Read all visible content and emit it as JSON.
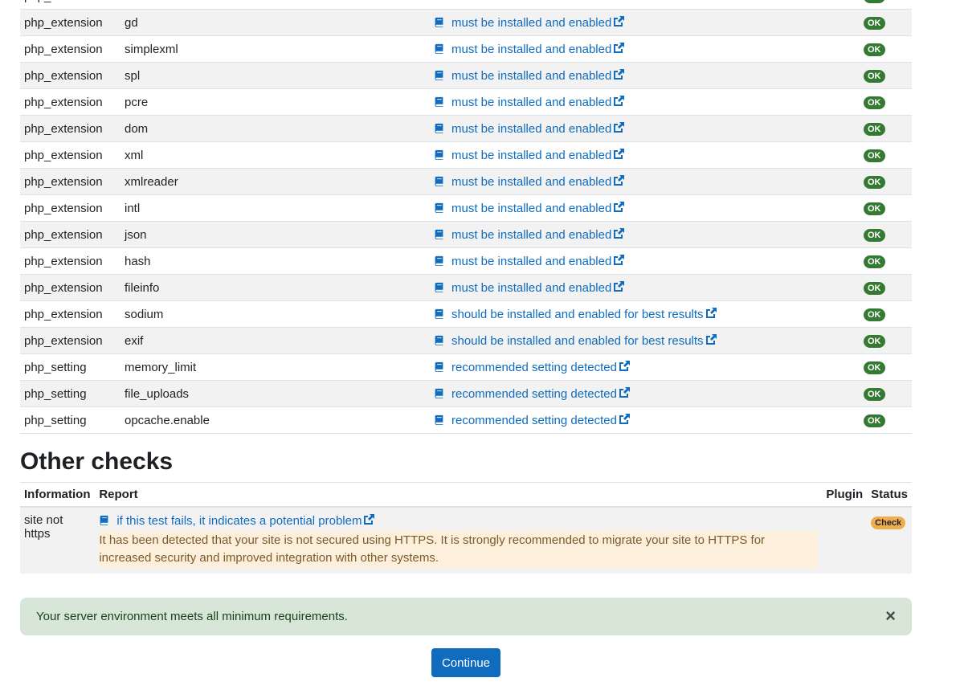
{
  "env_rows": [
    {
      "type": "php_extension",
      "name": "",
      "report": "",
      "status": "OK"
    },
    {
      "type": "php_extension",
      "name": "gd",
      "report": "must be installed and enabled",
      "status": "OK"
    },
    {
      "type": "php_extension",
      "name": "simplexml",
      "report": "must be installed and enabled",
      "status": "OK"
    },
    {
      "type": "php_extension",
      "name": "spl",
      "report": "must be installed and enabled",
      "status": "OK"
    },
    {
      "type": "php_extension",
      "name": "pcre",
      "report": "must be installed and enabled",
      "status": "OK"
    },
    {
      "type": "php_extension",
      "name": "dom",
      "report": "must be installed and enabled",
      "status": "OK"
    },
    {
      "type": "php_extension",
      "name": "xml",
      "report": "must be installed and enabled",
      "status": "OK"
    },
    {
      "type": "php_extension",
      "name": "xmlreader",
      "report": "must be installed and enabled",
      "status": "OK"
    },
    {
      "type": "php_extension",
      "name": "intl",
      "report": "must be installed and enabled",
      "status": "OK"
    },
    {
      "type": "php_extension",
      "name": "json",
      "report": "must be installed and enabled",
      "status": "OK"
    },
    {
      "type": "php_extension",
      "name": "hash",
      "report": "must be installed and enabled",
      "status": "OK"
    },
    {
      "type": "php_extension",
      "name": "fileinfo",
      "report": "must be installed and enabled",
      "status": "OK"
    },
    {
      "type": "php_extension",
      "name": "sodium",
      "report": "should be installed and enabled for best results",
      "status": "OK"
    },
    {
      "type": "php_extension",
      "name": "exif",
      "report": "should be installed and enabled for best results",
      "status": "OK"
    },
    {
      "type": "php_setting",
      "name": "memory_limit",
      "report": "recommended setting detected",
      "status": "OK"
    },
    {
      "type": "php_setting",
      "name": "file_uploads",
      "report": "recommended setting detected",
      "status": "OK"
    },
    {
      "type": "php_setting",
      "name": "opcache.enable",
      "report": "recommended setting detected",
      "status": "OK"
    }
  ],
  "other": {
    "heading": "Other checks",
    "headers": {
      "information": "Information",
      "report": "Report",
      "plugin": "Plugin",
      "status": "Status"
    },
    "row": {
      "information": "site not https",
      "report_link": "if this test fails, it indicates a potential problem",
      "warning": "It has been detected that your site is not secured using HTTPS. It is strongly recommended to migrate your site to HTTPS for increased security and improved integration with other systems.",
      "plugin": "",
      "status": "Check"
    }
  },
  "alert": {
    "message": "Your server environment meets all minimum requirements.",
    "close": "×"
  },
  "continue_button": "Continue",
  "colors": {
    "link": "#0f6cbf",
    "ok": "#357a32",
    "check": "#f0ad4e",
    "alert_bg": "#d7e6d6"
  }
}
